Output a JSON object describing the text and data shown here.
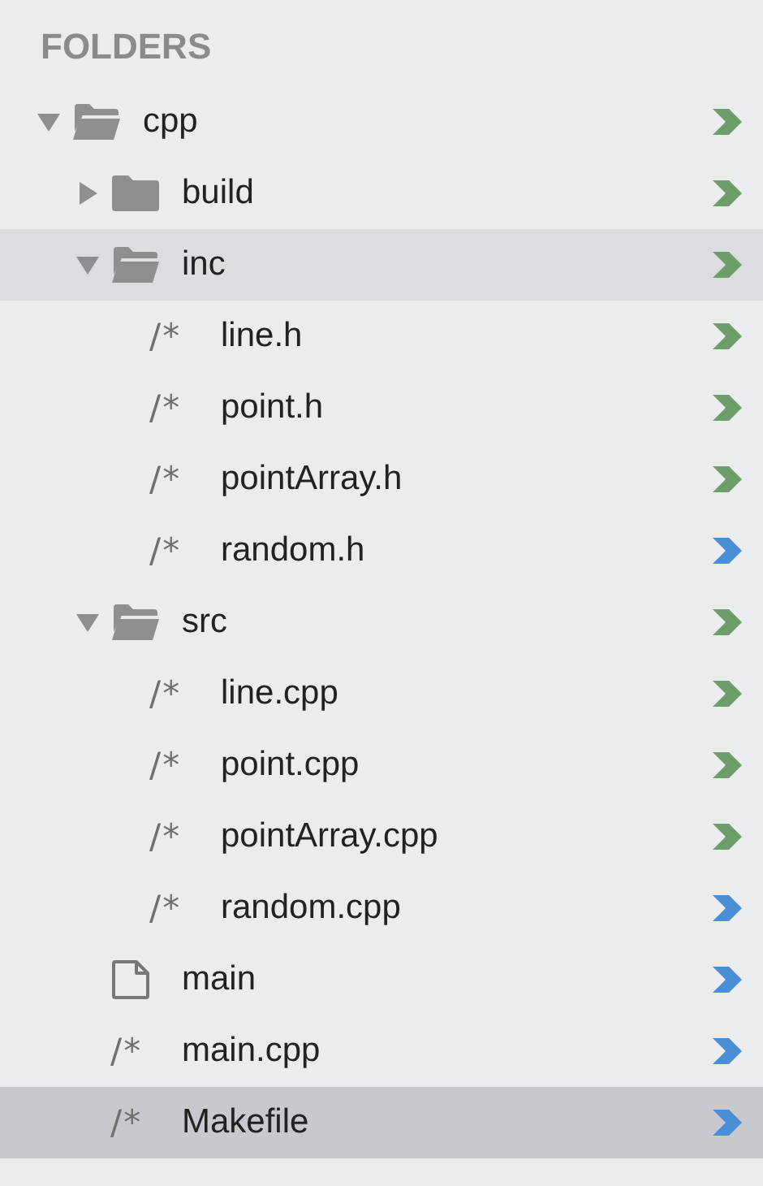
{
  "header": "FOLDERS",
  "tree": [
    {
      "kind": "folder",
      "name": "cpp",
      "expanded": true,
      "selected": false,
      "highlighted": false,
      "color": "#6b9e69",
      "children": [
        {
          "kind": "folder",
          "name": "build",
          "expanded": false,
          "selected": false,
          "highlighted": false,
          "color": "#6b9e69"
        },
        {
          "kind": "folder",
          "name": "inc",
          "expanded": true,
          "selected": false,
          "highlighted": true,
          "color": "#6b9e69",
          "children": [
            {
              "kind": "source",
              "glyph": "/*",
              "name": "line.h",
              "selected": false,
              "highlighted": false,
              "color": "#6b9e69"
            },
            {
              "kind": "source",
              "glyph": "/*",
              "name": "point.h",
              "selected": false,
              "highlighted": false,
              "color": "#6b9e69"
            },
            {
              "kind": "source",
              "glyph": "/*",
              "name": "pointArray.h",
              "selected": false,
              "highlighted": false,
              "color": "#6b9e69"
            },
            {
              "kind": "source",
              "glyph": "/*",
              "name": "random.h",
              "selected": false,
              "highlighted": false,
              "color": "#4a8fd6"
            }
          ]
        },
        {
          "kind": "folder",
          "name": "src",
          "expanded": true,
          "selected": false,
          "highlighted": false,
          "color": "#6b9e69",
          "children": [
            {
              "kind": "source",
              "glyph": "/*",
              "name": "line.cpp",
              "selected": false,
              "highlighted": false,
              "color": "#6b9e69"
            },
            {
              "kind": "source",
              "glyph": "/*",
              "name": "point.cpp",
              "selected": false,
              "highlighted": false,
              "color": "#6b9e69"
            },
            {
              "kind": "source",
              "glyph": "/*",
              "name": "pointArray.cpp",
              "selected": false,
              "highlighted": false,
              "color": "#6b9e69"
            },
            {
              "kind": "source",
              "glyph": "/*",
              "name": "random.cpp",
              "selected": false,
              "highlighted": false,
              "color": "#4a8fd6"
            }
          ]
        },
        {
          "kind": "file",
          "name": "main",
          "selected": false,
          "highlighted": false,
          "color": "#4a8fd6"
        },
        {
          "kind": "source",
          "glyph": "/*",
          "name": "main.cpp",
          "selected": false,
          "highlighted": false,
          "color": "#4a8fd6"
        },
        {
          "kind": "source",
          "glyph": "/*",
          "name": "Makefile",
          "selected": true,
          "highlighted": false,
          "color": "#4a8fd6"
        }
      ]
    }
  ]
}
